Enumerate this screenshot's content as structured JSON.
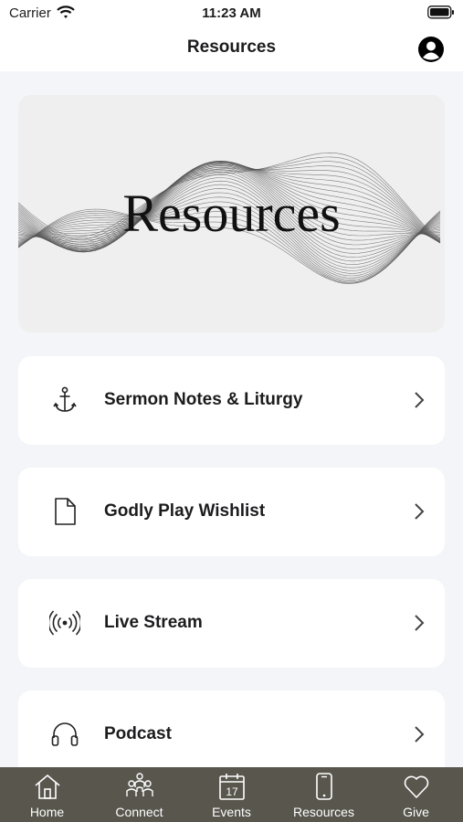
{
  "status": {
    "carrier": "Carrier",
    "time": "11:23 AM"
  },
  "nav": {
    "title": "Resources"
  },
  "hero": {
    "title": "Resources"
  },
  "items": [
    {
      "label": "Sermon Notes & Liturgy",
      "icon": "anchor-icon"
    },
    {
      "label": "Godly Play Wishlist",
      "icon": "document-icon"
    },
    {
      "label": "Live Stream",
      "icon": "broadcast-icon"
    },
    {
      "label": "Podcast",
      "icon": "headphones-icon"
    }
  ],
  "tabs": [
    {
      "label": "Home",
      "icon": "home-icon"
    },
    {
      "label": "Connect",
      "icon": "people-icon"
    },
    {
      "label": "Events",
      "icon": "calendar-icon",
      "badge": "17"
    },
    {
      "label": "Resources",
      "icon": "phone-icon"
    },
    {
      "label": "Give",
      "icon": "heart-icon"
    }
  ],
  "colors": {
    "background": "#f3f5f9",
    "tabbar": "#58564d",
    "card": "#ffffff"
  }
}
